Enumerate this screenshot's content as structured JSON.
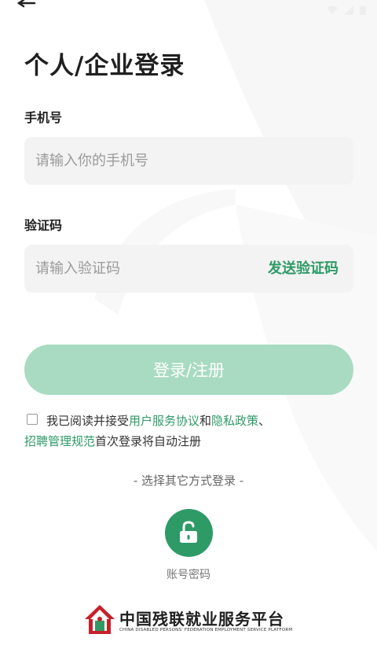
{
  "title": "个人/企业登录",
  "phone": {
    "label": "手机号",
    "placeholder": "请输入你的手机号"
  },
  "code": {
    "label": "验证码",
    "placeholder": "请输入验证码",
    "send_label": "发送验证码"
  },
  "login_button": "登录/注册",
  "agreement": {
    "prefix": "我已阅读并接受",
    "link_user": "用户服务协议",
    "and": "和",
    "link_privacy": "隐私政策",
    "sep": "、",
    "link_rules": "招聘管理规范",
    "suffix": "首次登录将自动注册"
  },
  "other_login": "- 选择其它方式登录 -",
  "account_login_label": "账号密码",
  "footer": {
    "name_cn": "中国残联就业服务平台",
    "name_en": "CHINA DISABLED PERSONS' FEDERATION EMPLOYMENT SERVICE PLATFORM"
  },
  "colors": {
    "accent": "#2e9a66",
    "button_disabled": "#a8dbc1",
    "input_bg": "#f3f3f3"
  },
  "icons": {
    "back": "back-arrow-icon",
    "account": "unlock-icon",
    "logo": "house-logo-icon"
  }
}
